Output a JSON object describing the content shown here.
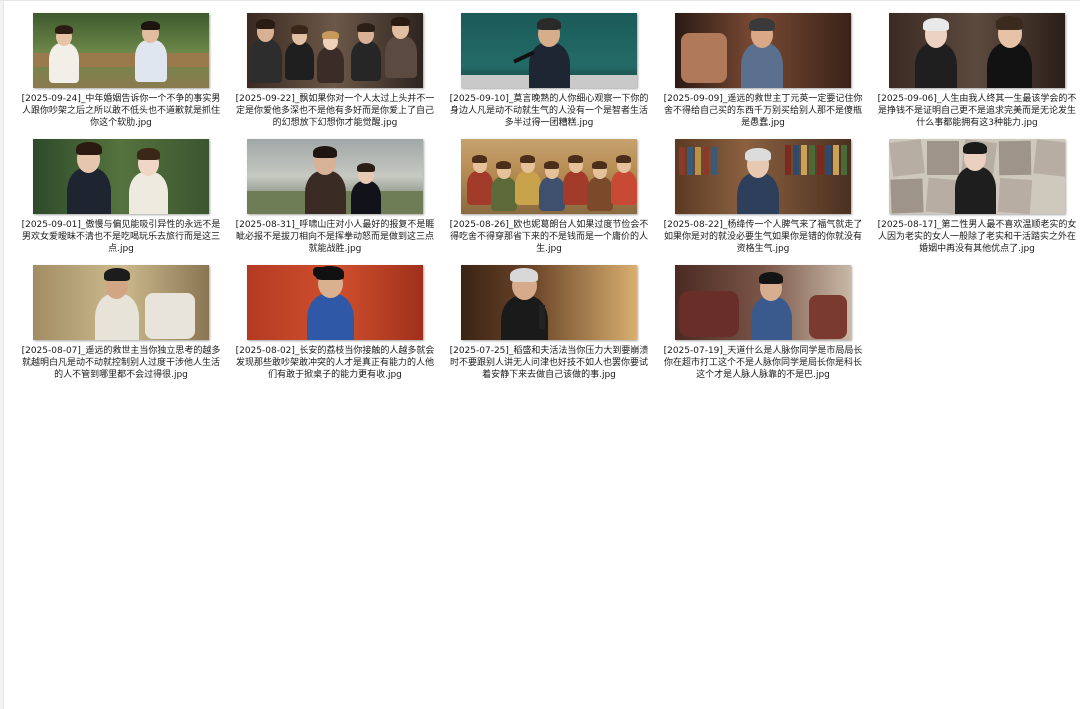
{
  "folder": {
    "items": [
      {
        "name": "[2025-09-24]_中年婚姻告诉你一个不争的事实男人跟你吵架之后之所以敢不低头也不道歉就是抓住你这个软肋.jpg",
        "scene": "couple-bench"
      },
      {
        "name": "[2025-09-22]_飘如果你对一个人太过上头并不一定是你爱他多深也不是他有多好而是你爱上了自己的幻想放下幻想你才能觉醒.jpg",
        "scene": "crowd-party"
      },
      {
        "name": "[2025-09-10]_莫言晚熟的人你细心观察一下你的身边人凡是动不动就生气的人没有一个是智者生活多半过得一团糟糕.jpg",
        "scene": "speaker-mic"
      },
      {
        "name": "[2025-09-09]_遥远的救世主丁元英一定要记住你舍不得给自己买的东西千万别买给别人那不是傻瓶是愚蠢.jpg",
        "scene": "old-man-sofa"
      },
      {
        "name": "[2025-09-06]_人生由我人终其一生最该学会的不是挣钱不是证明自己更不是追求完美而是无论发生什么事都能拥有这3种能力.jpg",
        "scene": "two-portraits"
      },
      {
        "name": "[2025-09-01]_傲慢与偏见能吸引异性的永远不是男欢女爱暧昧不清也不是吃喝玩乐去旅行而是这三点.jpg",
        "scene": "period-couple"
      },
      {
        "name": "[2025-08-31]_呼啸山庄对小人最好的报复不是睚眦必报不是拔刀相向不是挥拳动怒而是做到这三点就能战胜.jpg",
        "scene": "embrace"
      },
      {
        "name": "[2025-08-26]_欧也妮葛朗台人如果过度节俭会不得吃舍不得穿那省下来的不是钱而是一个庸价的人生.jpg",
        "scene": "painting"
      },
      {
        "name": "[2025-08-22]_杨绛传一个人脾气来了福气就走了如果你是对的就没必要生气如果你是错的你就没有资格生气.jpg",
        "scene": "old-woman-books"
      },
      {
        "name": "[2025-08-17]_第二性男人最不喜欢温顺老实的女人因为老实的女人一般除了老实和干活踏实之外在婚姻中再没有其他优点了.jpg",
        "scene": "collage"
      },
      {
        "name": "[2025-08-07]_遥远的救世主当你独立思考的越多就越明白凡是动不动就控制别人过度干涉他人生活的人不管到哪里都不会过得很.jpg",
        "scene": "man-chair"
      },
      {
        "name": "[2025-08-02]_长安的荔枝当你接触的人越多就会发现那些敢吵架敢冲突的人才是真正有能力的人他们有敢于掀桌子的能力更有收.jpg",
        "scene": "tang-official"
      },
      {
        "name": "[2025-07-25]_稻盛和夫活法当你压力大到要崩溃时不要跟别人讲无人问津也好技不如人也罢你要试着安静下来去做自己该做的事.jpg",
        "scene": "elder-mic"
      },
      {
        "name": "[2025-07-19]_天道什么是人脉你同学是市局局长你在超市打工这个不是人脉你同学是局长你是科长这个才是人脉人脉靠的不是巴.jpg",
        "scene": "man-sofa-room"
      }
    ]
  },
  "colors": {
    "background": "#ffffff",
    "caption_text": "#1a1a1a"
  }
}
